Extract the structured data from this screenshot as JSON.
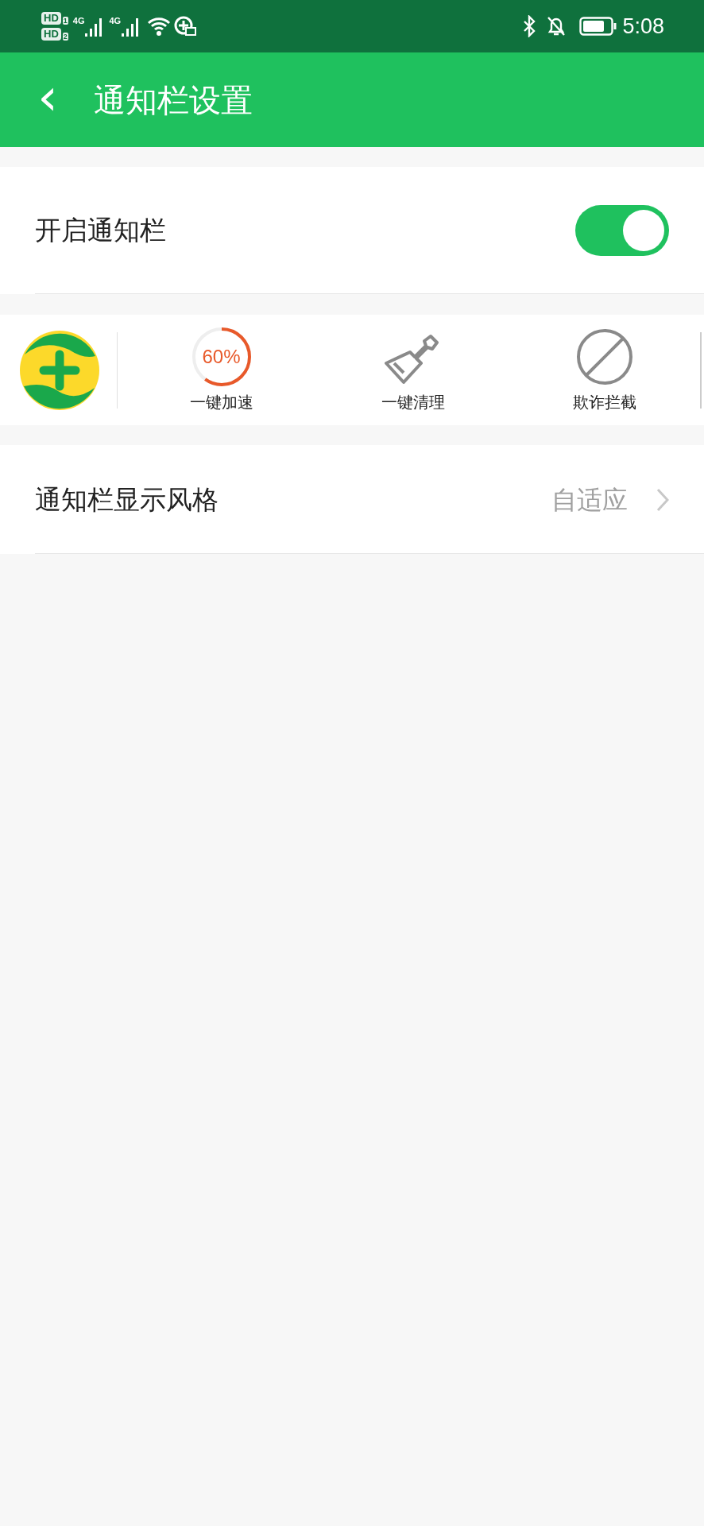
{
  "status_bar": {
    "sims": [
      {
        "label": "HD",
        "index": "1"
      },
      {
        "label": "HD",
        "index": "2"
      }
    ],
    "networks": [
      "4G",
      "4G"
    ],
    "time": "5:08"
  },
  "header": {
    "back": "‹",
    "title": "通知栏设置"
  },
  "toggle_row": {
    "label": "开启通知栏",
    "on": true
  },
  "shortcuts": [
    {
      "kind": "speed",
      "value": "60%",
      "level": 0.6,
      "label": "一键加速"
    },
    {
      "kind": "clean",
      "label": "一键清理"
    },
    {
      "kind": "block",
      "label": "欺诈拦截"
    }
  ],
  "style_row": {
    "label": "通知栏显示风格",
    "value": "自适应"
  }
}
